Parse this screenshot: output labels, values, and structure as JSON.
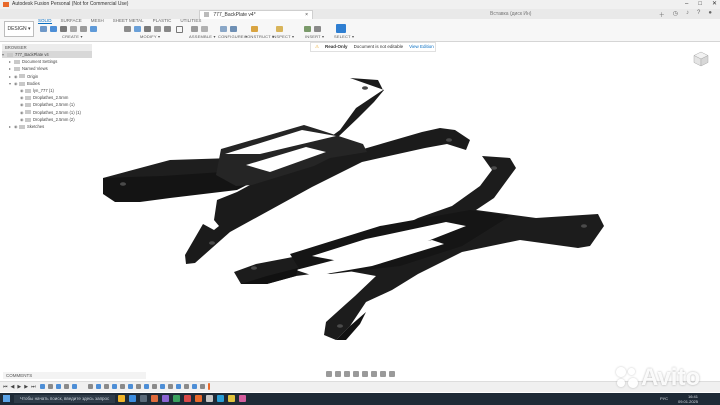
{
  "window": {
    "title": "Autodesk Fusion Personal (Not for Commercial Use)"
  },
  "doc_tab": {
    "label": "777_BackPlate v4*",
    "close": "×"
  },
  "user_status": "Вставка (диск Ин)",
  "toolbar": {
    "design_label": "DESIGN ▾",
    "workspace_tabs": [
      "SOLID",
      "SURFACE",
      "MESH",
      "SHEET METAL",
      "PLASTIC",
      "UTILITIES"
    ],
    "groups": [
      "CREATE ▾",
      "MODIFY ▾",
      "ASSEMBLE ▾",
      "CONFIGURE ▾",
      "CONSTRUCT ▾",
      "INSPECT ▾",
      "INSERT ▾",
      "SELECT ▾"
    ]
  },
  "infobar": {
    "label": "Read-Only",
    "message": "Document is not editable",
    "link": "View Edition"
  },
  "browser": {
    "header": "BROWSER",
    "nodes": [
      {
        "label": "777_BackPlate v4",
        "level": 0,
        "kind": "root"
      },
      {
        "label": "Document Settings",
        "level": 1,
        "kind": "folder"
      },
      {
        "label": "Named Views",
        "level": 1,
        "kind": "folder"
      },
      {
        "label": "Origin",
        "level": 1,
        "kind": "folder"
      },
      {
        "label": "Bodies",
        "level": 1,
        "kind": "folder"
      },
      {
        "label": "lyn_777 (1)",
        "level": 2,
        "kind": "body"
      },
      {
        "label": "Droplathes_2.5mm",
        "level": 2,
        "kind": "body"
      },
      {
        "label": "Droplathes_2.5mm (1)",
        "level": 2,
        "kind": "body"
      },
      {
        "label": "Droplathes_2.5mm (1) (1)",
        "level": 2,
        "kind": "body"
      },
      {
        "label": "Droplathes_2.5mm (2)",
        "level": 2,
        "kind": "body"
      },
      {
        "label": "Sketches",
        "level": 1,
        "kind": "folder"
      }
    ]
  },
  "comments": {
    "label": "COMMENTS"
  },
  "taskbar": {
    "search_placeholder": "Чтобы начать поиск, введите здесь запрос",
    "tray_lang": "РУС",
    "tray_time": "16:41",
    "tray_date": "09.01.2025"
  },
  "watermark": {
    "text": "Avito"
  },
  "colors": {
    "accent": "#0a6fc2",
    "part": "#1b1b1b",
    "taskbar": "#1e2a36"
  }
}
